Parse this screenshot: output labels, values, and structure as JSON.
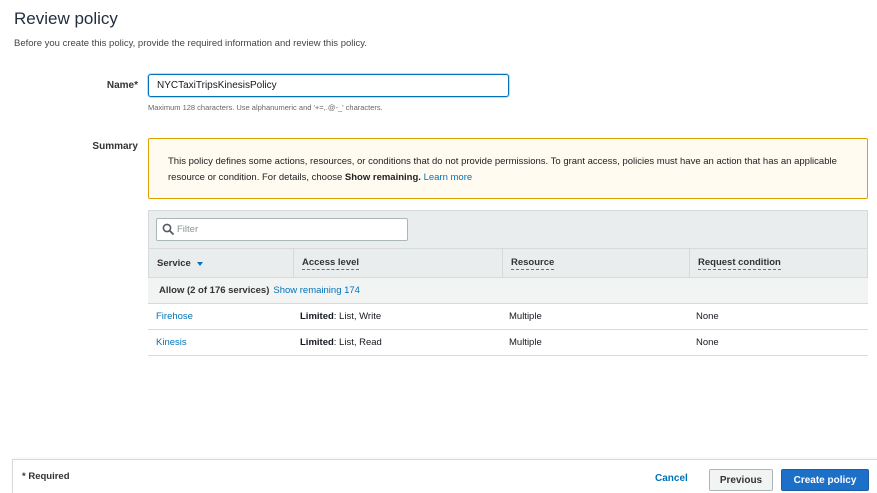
{
  "page": {
    "title": "Review policy",
    "description": "Before you create this policy, provide the required information and review this policy."
  },
  "name_field": {
    "label": "Name*",
    "value": "NYCTaxiTripsKinesisPolicy",
    "hint": "Maximum 128 characters. Use alphanumeric and '+=,.@-_' characters."
  },
  "summary": {
    "label": "Summary",
    "warning": {
      "text": "This policy defines some actions, resources, or conditions that do not provide permissions. To grant access, policies must have an action that has an applicable resource or condition. For details, choose ",
      "bold": "Show remaining.",
      "link": "Learn more"
    }
  },
  "table": {
    "filter_placeholder": "Filter",
    "columns": [
      "Service",
      "Access level",
      "Resource",
      "Request condition"
    ],
    "group": {
      "label": "Allow (2 of 176 services)",
      "link": "Show remaining 174"
    },
    "rows": [
      {
        "service": "Firehose",
        "access_bold": "Limited",
        "access_rest": ": List, Write",
        "resource": "Multiple",
        "condition": "None"
      },
      {
        "service": "Kinesis",
        "access_bold": "Limited",
        "access_rest": ": List, Read",
        "resource": "Multiple",
        "condition": "None"
      }
    ]
  },
  "footer": {
    "required_note": "* Required",
    "cancel": "Cancel",
    "previous": "Previous",
    "create": "Create policy"
  },
  "icons": {
    "search": "search-icon",
    "sort": "caret-down-icon"
  },
  "colors": {
    "link": "#0073bb",
    "primary_button": "#1d70c7",
    "warning_border": "#e0a100",
    "warning_bg": "#fffbf0"
  }
}
